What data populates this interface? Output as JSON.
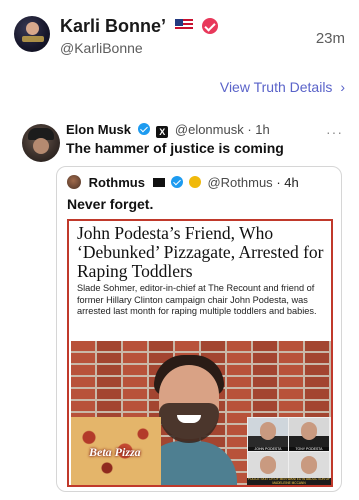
{
  "header": {
    "display_name": "Karli Bonne’",
    "handle": "@KarliBonne",
    "timestamp": "23m",
    "flag_icon": "us-flag-icon",
    "verified_icon": "verified-check-icon"
  },
  "view_details": {
    "label": "View Truth Details",
    "chevron": "›"
  },
  "tweet": {
    "author_name": "Elon Musk",
    "author_handle": "@elonmusk",
    "age": "· 1h",
    "text": "The hammer of justice is coming",
    "more_label": "···",
    "x_badge": "X"
  },
  "quote": {
    "author_name": "Rothmus",
    "author_handle": "@Rothmus",
    "age": "· 4h",
    "text": "Never forget."
  },
  "article": {
    "headline": "John Podesta’s Friend, Who ‘Debunked’ Pizzagate, Arrested for Raping Toddlers",
    "summary": "Slade Sohmer, editor-in-chief at The Recount and friend of former Hillary Clinton campaign chair John Podesta, was arrested last month for raping multiple toddlers and babies.",
    "pizza_label": "Beta Pizza",
    "inset_captions": [
      "JOHN PODESTA",
      "TONY PODESTA"
    ],
    "inset_footer": "POLICE SKETCH OF MEN WANTED IN ABDUCTION OF MADELEINE MCCANN"
  },
  "colors": {
    "link": "#5a63c9",
    "verified_pink": "#e8395b",
    "verified_blue": "#1d9bf0",
    "article_border": "#c0392b"
  }
}
